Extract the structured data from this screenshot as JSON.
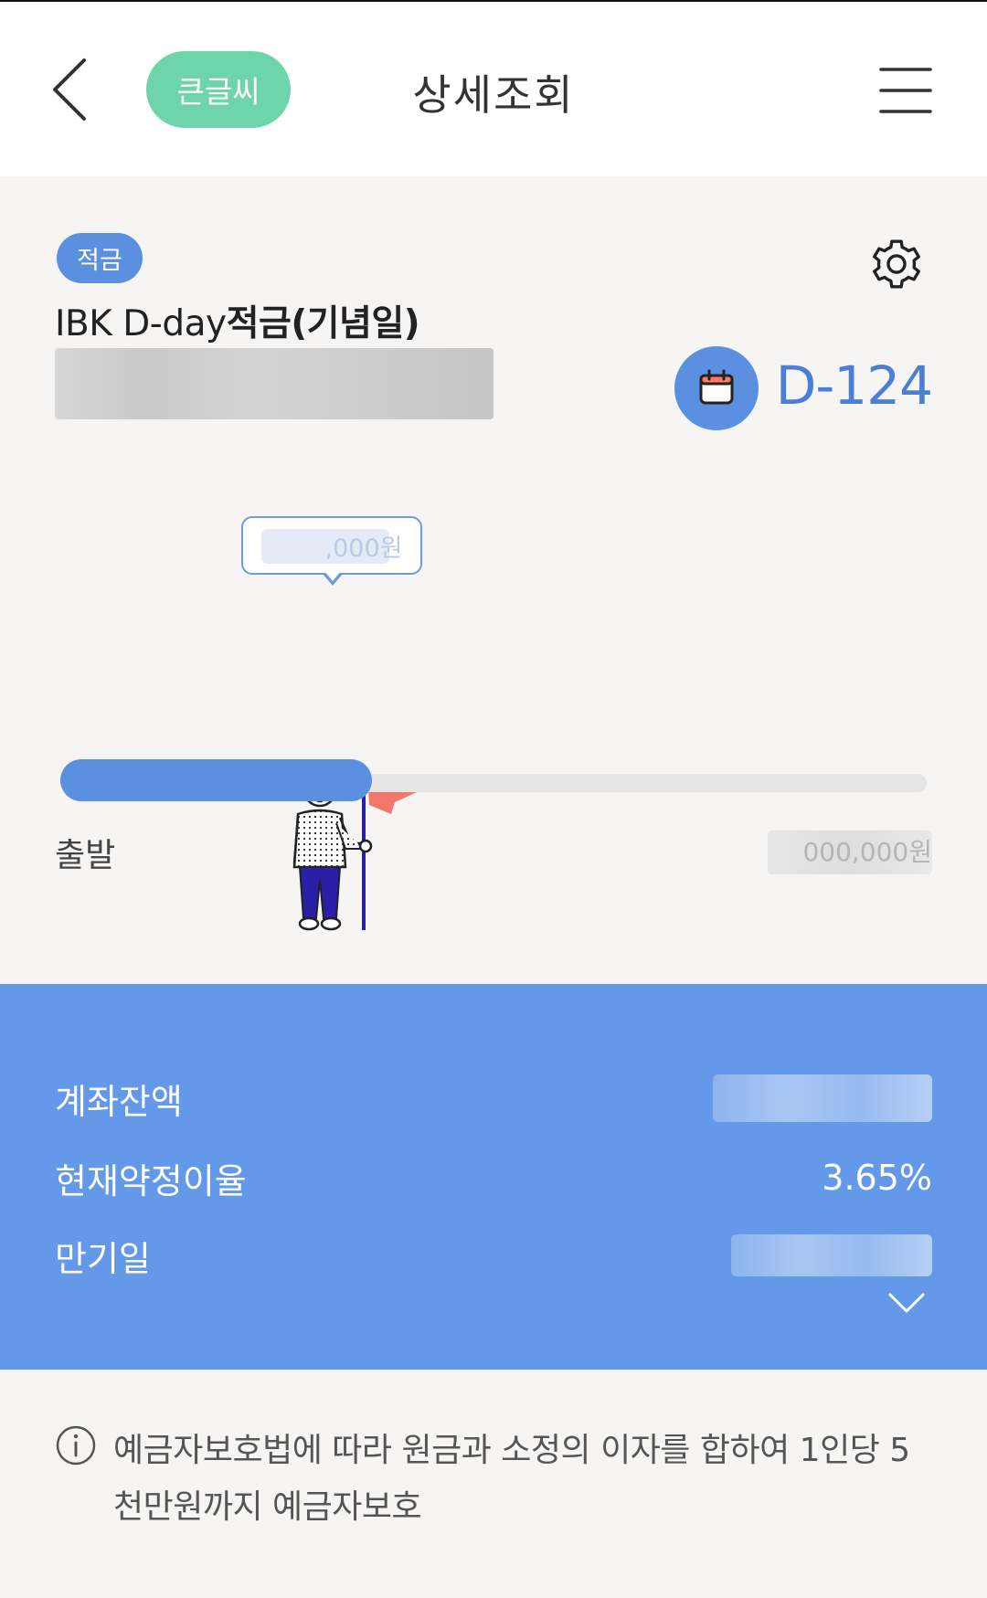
{
  "header": {
    "title": "상세조회",
    "font_size_button": "큰글씨"
  },
  "product": {
    "badge": "적금",
    "name_prefix": "IBK D-day",
    "name_bold": "적금(기념일)",
    "dday": "D-124",
    "tooltip_amount": ",000원",
    "progress_fraction": 0.36
  },
  "progress": {
    "start_label": "출발",
    "goal_amount": "000,000원"
  },
  "details": {
    "balance_label": "계좌잔액",
    "rate_label": "현재약정이율",
    "rate_value": "3.65%",
    "maturity_label": "만기일"
  },
  "notice": {
    "text": "예금자보호법에 따라 원금과 소정의 이자를 합하여 1인당 5천만원까지 예금자보호"
  },
  "colors": {
    "accent_blue": "#5b90e0",
    "panel_blue": "#6399e8",
    "green_button": "#6dd5a9",
    "dday_blue": "#4a7fd6"
  }
}
